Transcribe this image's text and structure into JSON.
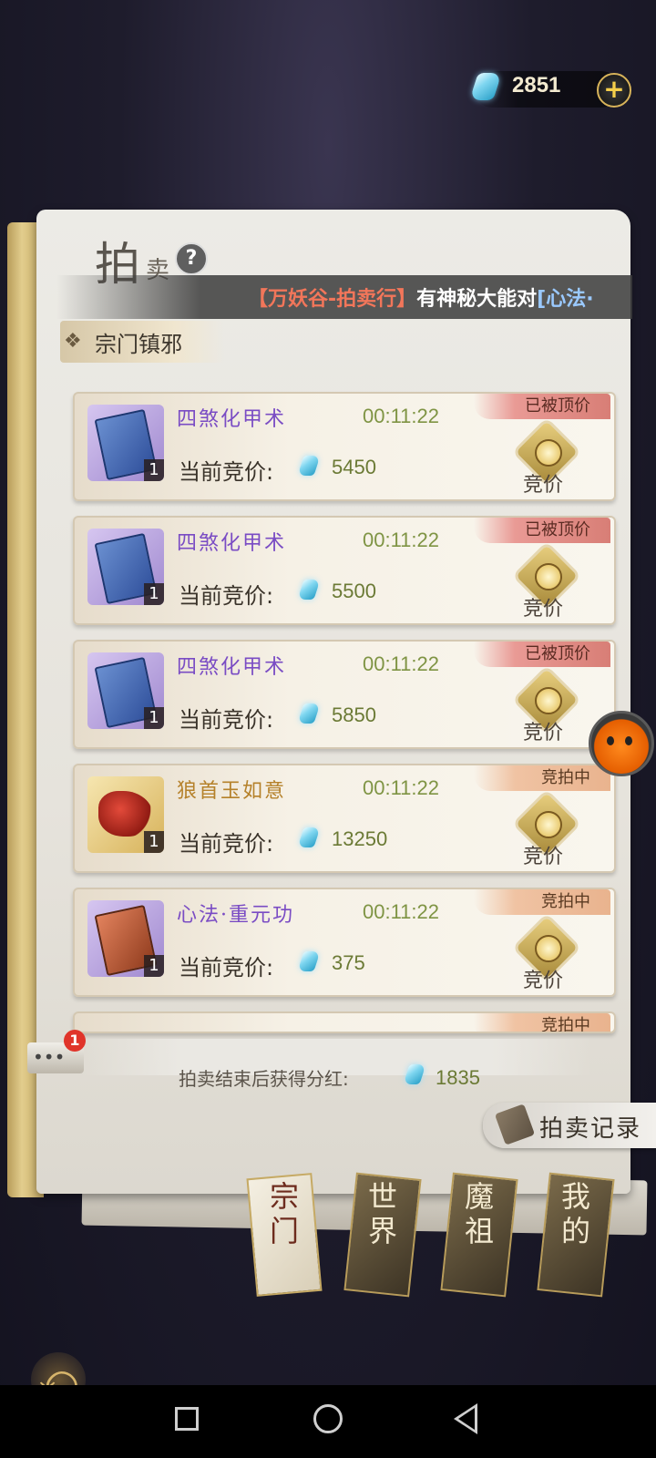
{
  "currency": {
    "value": "2851",
    "add_symbol": "+"
  },
  "header": {
    "title_main": "拍",
    "title_sub": "卖",
    "help_symbol": "?"
  },
  "marquee": {
    "prefix": "【万妖谷-拍卖行】",
    "text": "有神秘大能对",
    "highlight": "[心法·"
  },
  "section": {
    "title": "宗门镇邪",
    "icon": "diamond-ornament-icon"
  },
  "bid_label": "当前竞价:",
  "bid_button_label": "竞价",
  "items": [
    {
      "name": "四煞化甲术",
      "timer": "00:11:22",
      "bid": "5450",
      "count": "1",
      "status": "已被顶价",
      "status_type": "topped",
      "thumb": "blue-book-icon",
      "name_color": "purple"
    },
    {
      "name": "四煞化甲术",
      "timer": "00:11:22",
      "bid": "5500",
      "count": "1",
      "status": "已被顶价",
      "status_type": "topped",
      "thumb": "blue-book-icon",
      "name_color": "purple"
    },
    {
      "name": "四煞化甲术",
      "timer": "00:11:22",
      "bid": "5850",
      "count": "1",
      "status": "已被顶价",
      "status_type": "topped",
      "thumb": "blue-book-icon",
      "name_color": "purple"
    },
    {
      "name": "狼首玉如意",
      "timer": "00:11:22",
      "bid": "13250",
      "count": "1",
      "status": "竞拍中",
      "status_type": "active",
      "thumb": "red-dragon-scepter-icon",
      "name_color": "gold"
    },
    {
      "name": "心法·重元功",
      "timer": "00:11:22",
      "bid": "375",
      "count": "1",
      "status": "竞拍中",
      "status_type": "active",
      "thumb": "red-book-icon",
      "name_color": "purple"
    }
  ],
  "partial_item_status": "竞拍中",
  "dividend": {
    "label": "拍卖结束后获得分红:",
    "value": "1835"
  },
  "record_button": "拍卖记录",
  "chat": {
    "badge": "1"
  },
  "tabs": [
    {
      "label": "宗门",
      "active": true
    },
    {
      "label": "世界",
      "active": false
    },
    {
      "label": "魔祖",
      "active": false
    },
    {
      "label": "我的",
      "active": false
    }
  ],
  "colors": {
    "gem": "#7fd6f0",
    "topped": "#d87e76",
    "active": "#e9b38e",
    "bid_value": "#6b7a35"
  }
}
